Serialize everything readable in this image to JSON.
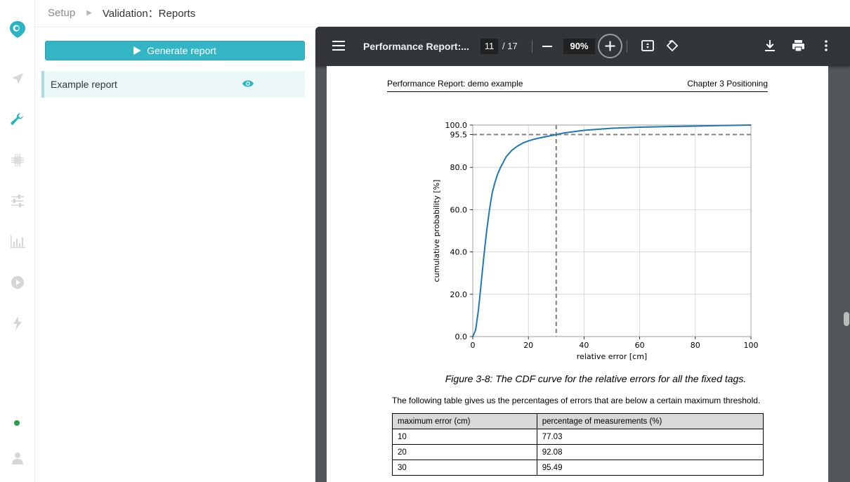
{
  "breadcrumb": {
    "parent": "Setup",
    "current": "Validation：Reports"
  },
  "sidebar": {
    "icons": [
      "logo-pin-icon",
      "send-icon",
      "wrench-icon",
      "chip-icon",
      "sliders-icon",
      "bar-chart-icon",
      "play-circle-icon",
      "bolt-icon",
      "user-icon"
    ],
    "status_color": "#2fa04a"
  },
  "panel": {
    "generate_label": "Generate report",
    "reports": [
      {
        "name": "Example report"
      }
    ]
  },
  "viewer": {
    "title": "Performance Report:...",
    "current_page": "11",
    "total_pages": "/ 17",
    "zoom": "90%"
  },
  "document": {
    "header_left": "Performance Report: demo example",
    "header_right": "Chapter 3 Positioning",
    "caption": "Figure 3-8: The CDF curve for the relative errors for all the fixed tags.",
    "paragraph": "The following table gives us the percentages of errors that are below a certain maximum threshold.",
    "table": {
      "headers": [
        "maximum error (cm)",
        "percentage of measurements (%)"
      ],
      "rows": [
        [
          "10",
          "77.03"
        ],
        [
          "20",
          "92.08"
        ],
        [
          "30",
          "95.49"
        ]
      ]
    }
  },
  "chart_data": {
    "type": "line",
    "title": "",
    "xlabel": "relative error [cm]",
    "ylabel": "cumulative probability [%]",
    "xlim": [
      0,
      100
    ],
    "ylim": [
      0,
      100
    ],
    "x_ticks": [
      "0",
      "20",
      "40",
      "60",
      "80",
      "100"
    ],
    "y_ticks": [
      "0.0",
      "20.0",
      "40.0",
      "60.0",
      "80.0",
      "95.5",
      "100.0"
    ],
    "grid": true,
    "reference_lines": {
      "x": 30,
      "y": 95.5,
      "style": "dashed",
      "color": "#808080"
    },
    "series": [
      {
        "color": "#1f77b4",
        "x": [
          0,
          1,
          2,
          3,
          4,
          5,
          6,
          7,
          8,
          9,
          10,
          12,
          14,
          16,
          18,
          20,
          22,
          25,
          28,
          30,
          33,
          37,
          40,
          45,
          50,
          60,
          70,
          80,
          90,
          100
        ],
        "y": [
          0,
          3,
          12,
          25,
          38,
          50,
          60,
          68,
          73,
          77,
          80,
          85,
          88,
          90,
          91.5,
          92.5,
          93.3,
          94.2,
          95,
          95.5,
          96.3,
          97,
          97.5,
          98,
          98.5,
          99,
          99.3,
          99.5,
          99.8,
          100
        ]
      }
    ]
  }
}
